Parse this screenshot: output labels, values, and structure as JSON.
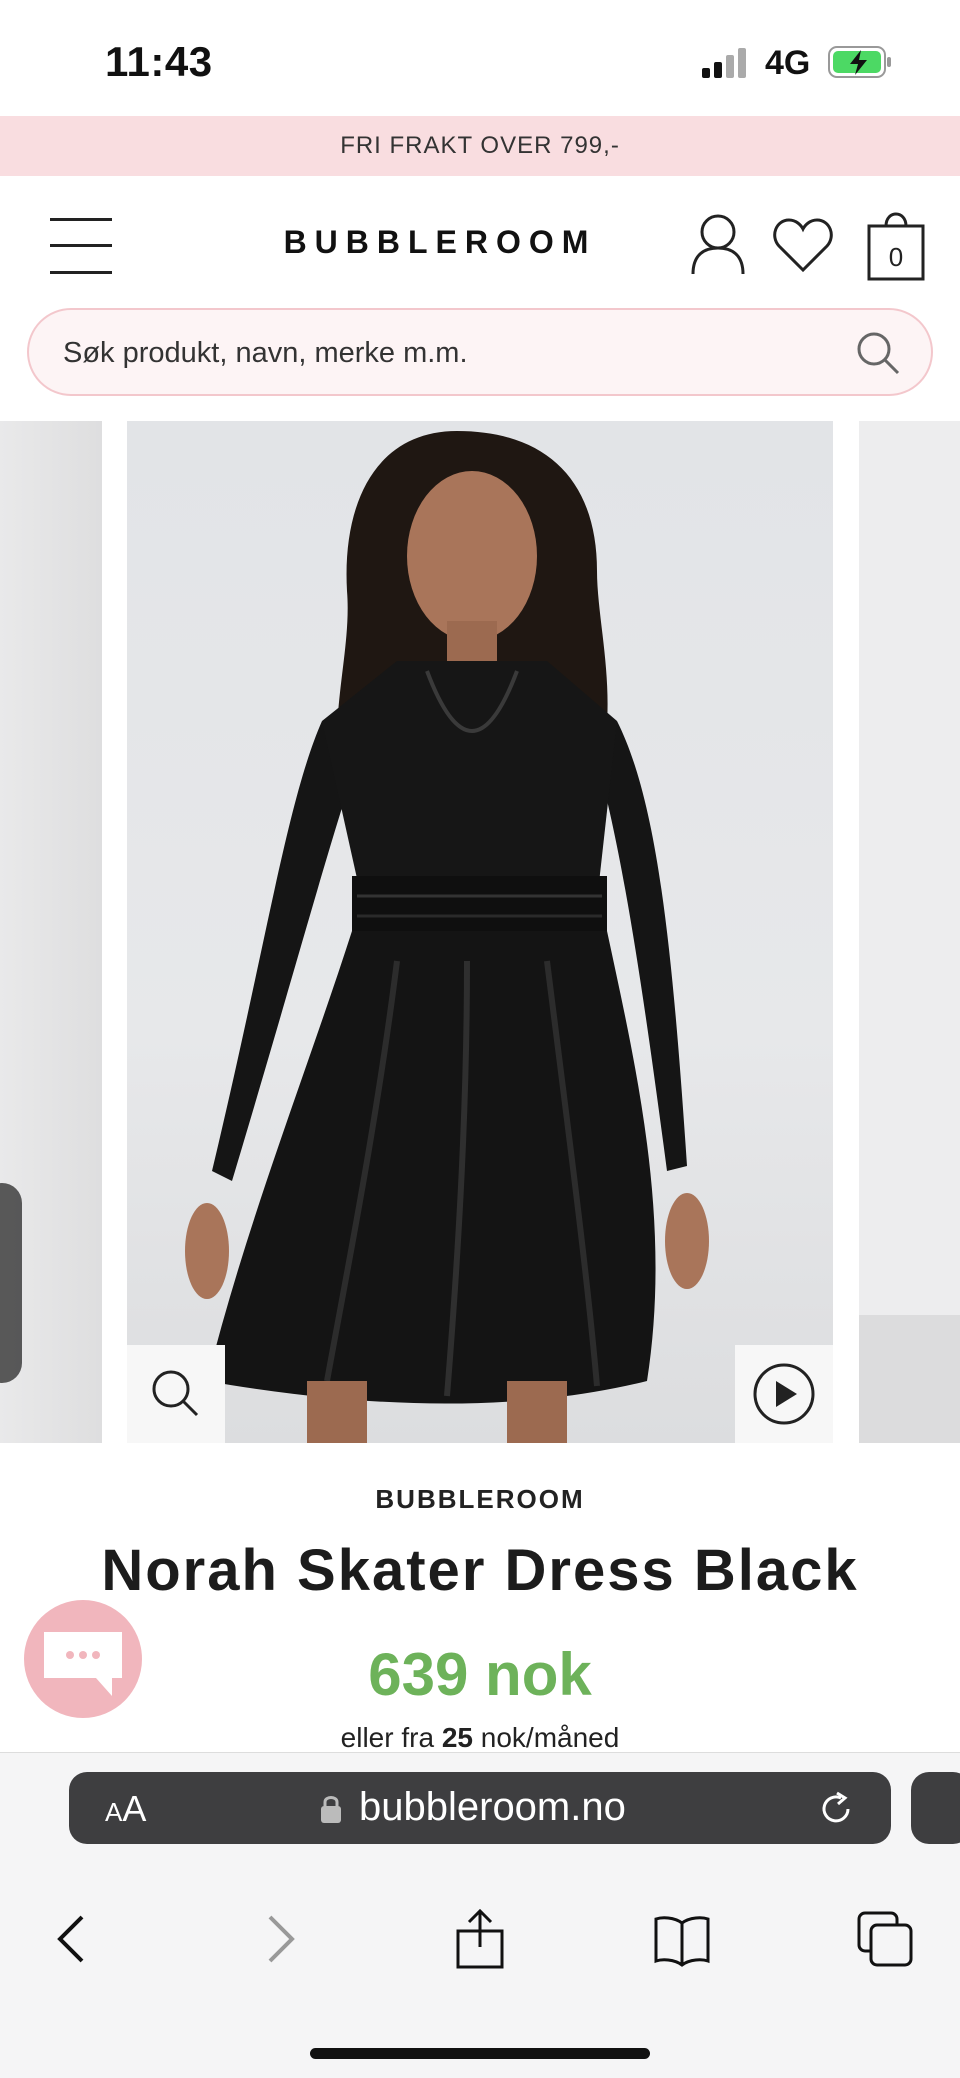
{
  "status_bar": {
    "time": "11:43",
    "network": "4G",
    "battery_charging": true
  },
  "promo": {
    "text": "FRI FRAKT OVER 799,-"
  },
  "header": {
    "logo": "BUBBLEROOM",
    "cart_count": "0"
  },
  "search": {
    "placeholder": "Søk produkt, navn, merke m.m."
  },
  "product": {
    "brand": "BUBBLEROOM",
    "name": "Norah Skater Dress Black",
    "price": "639 nok",
    "installment_prefix": "eller fra",
    "installment_amount": "25",
    "installment_suffix": "nok/måned"
  },
  "browser": {
    "text_size_label_small": "A",
    "text_size_label_large": "A",
    "url": "bubbleroom.no"
  },
  "colors": {
    "promo_bg": "#f9dde0",
    "price_green": "#6db25a",
    "chat_pink": "#f1b6bd",
    "url_bar": "#3e3e40"
  },
  "icons": [
    "menu-icon",
    "user-icon",
    "heart-icon",
    "bag-icon",
    "search-icon",
    "zoom-icon",
    "play-icon",
    "chat-icon",
    "lock-icon",
    "reload-icon",
    "back-icon",
    "forward-icon",
    "share-icon",
    "bookmarks-icon",
    "tabs-icon"
  ]
}
